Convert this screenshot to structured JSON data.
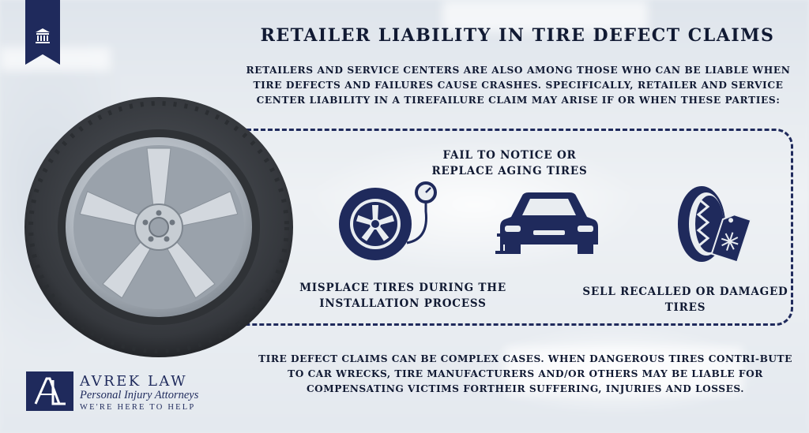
{
  "header": {
    "title": "RETAILER LIABILITY IN TIRE DEFECT CLAIMS",
    "intro": "RETAILERS AND SERVICE CENTERS ARE ALSO AMONG THOSE WHO CAN BE LIABLE WHEN TIRE DEFECTS AND FAILURES CAUSE CRASHES. SPECIFICALLY, RETAILER AND SERVICE CENTER LIABILITY IN A TIREFAILURE CLAIM MAY ARISE IF OR WHEN THESE PARTIES:"
  },
  "items": [
    {
      "text": "FAIL TO NOTICE OR REPLACE AGING TIRES",
      "icon": "car-on-jack-icon"
    },
    {
      "text": "MISPLACE TIRES DURING THE INSTALLATION PROCESS",
      "icon": "tire-pressure-gauge-icon"
    },
    {
      "text": "SELL RECALLED OR DAMAGED TIRES",
      "icon": "tire-tag-icon"
    }
  ],
  "footer": {
    "text": "TIRE DEFECT CLAIMS CAN BE COMPLEX CASES. WHEN DANGEROUS TIRES CONTRI-BUTE TO CAR WRECKS, TIRE MANUFACTURERS AND/OR OTHERS MAY BE LIABLE FOR COMPENSATING VICTIMS FORTHEIR SUFFERING, INJURIES AND LOSSES."
  },
  "logo": {
    "mark": "AL",
    "brand": "AVREK LAW",
    "subtitle": "Personal Injury Attorneys",
    "tagline": "WE'RE HERE TO HELP"
  },
  "colors": {
    "navy": "#1f2a5c",
    "text": "#111a33",
    "tire": "#3a3d42",
    "rim": "#b9c0c8"
  }
}
